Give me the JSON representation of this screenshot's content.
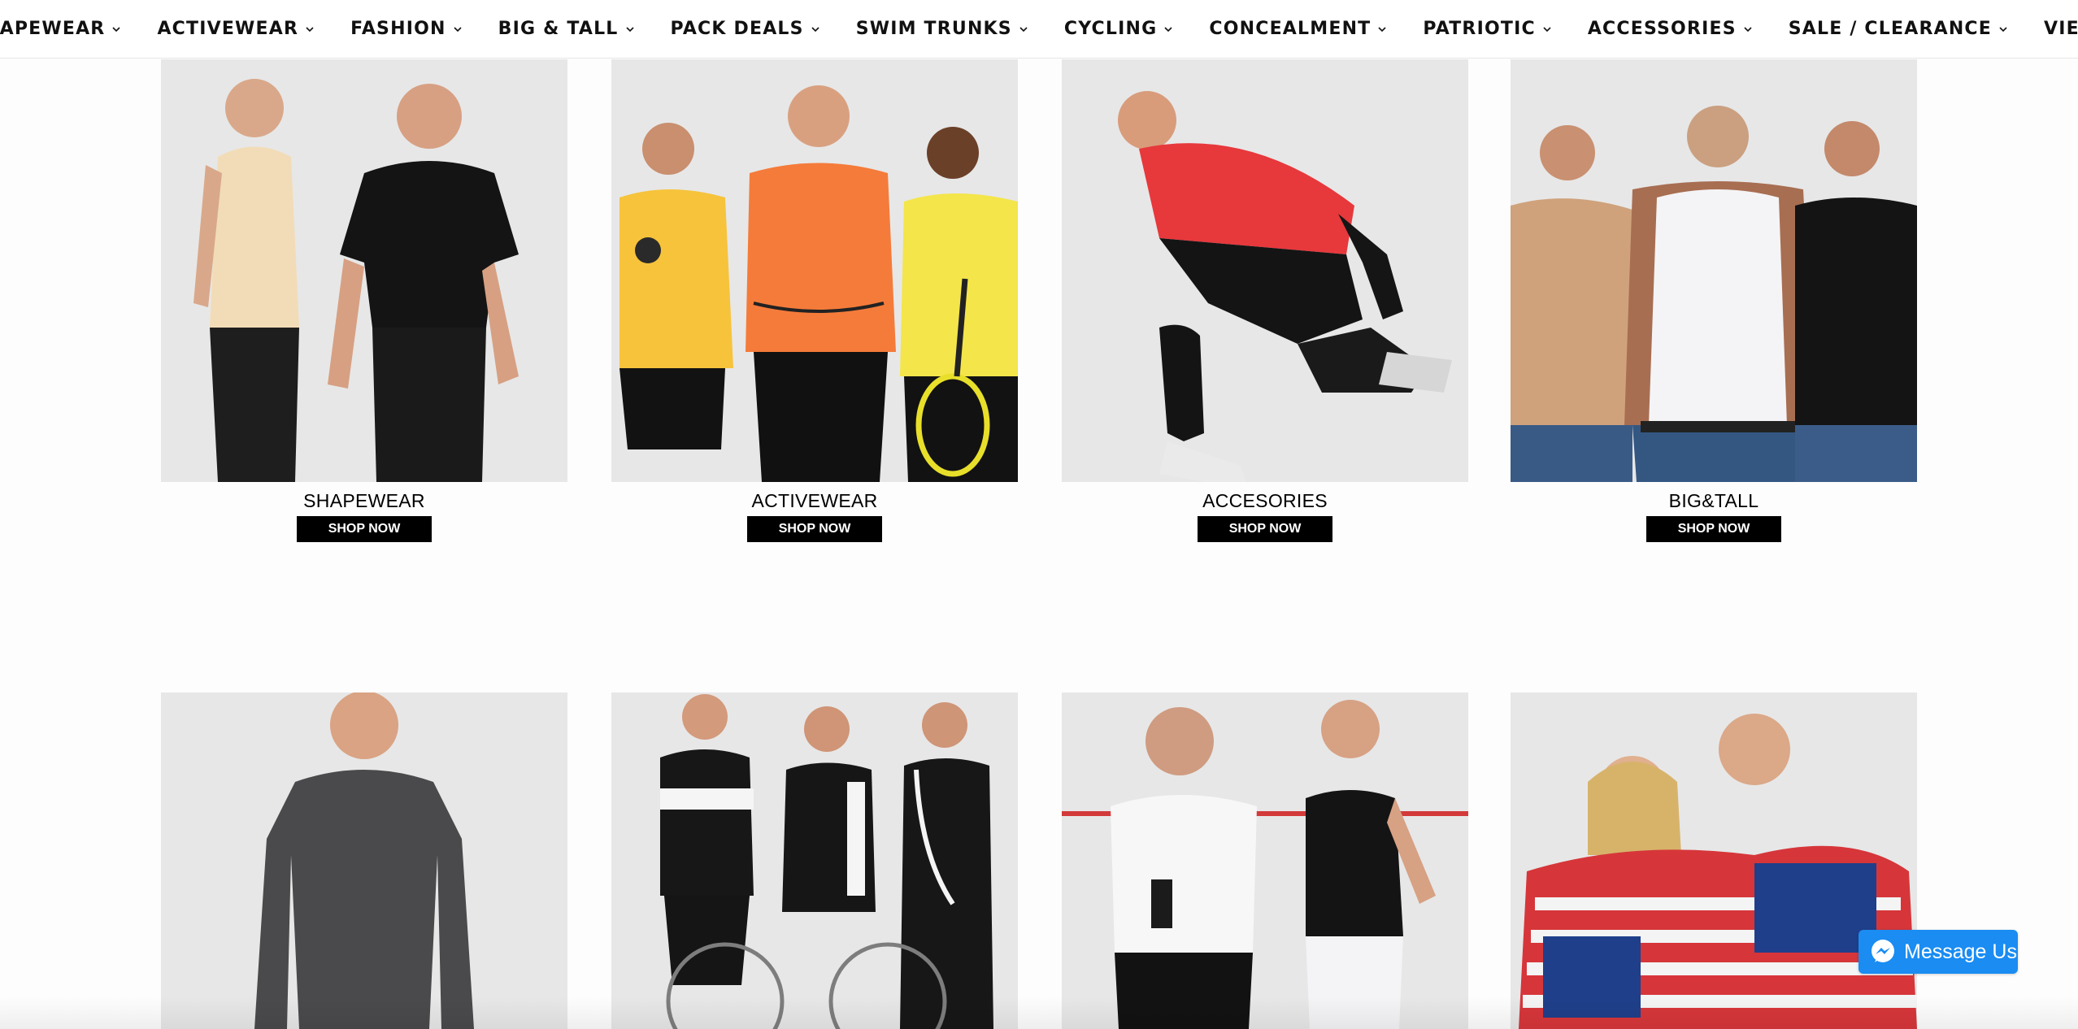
{
  "nav": {
    "items": [
      {
        "label": "MEN SHAPEWEAR"
      },
      {
        "label": "ACTIVEWEAR"
      },
      {
        "label": "FASHION"
      },
      {
        "label": "BIG & TALL"
      },
      {
        "label": "PACK DEALS"
      },
      {
        "label": "SWIM TRUNKS"
      },
      {
        "label": "CYCLING"
      },
      {
        "label": "CONCEALMENT"
      },
      {
        "label": "PATRIOTIC"
      },
      {
        "label": "ACCESSORIES"
      },
      {
        "label": "SALE / CLEARANCE"
      },
      {
        "label": "VIEW ALL"
      }
    ],
    "dropdown_icon": "chevron-down-icon"
  },
  "tiles": [
    {
      "caption": "SHAPEWEAR",
      "button": "SHOP NOW",
      "photo": "two-men-shapewear-photo"
    },
    {
      "caption": "ACTIVEWEAR",
      "button": "SHOP NOW",
      "photo": "three-men-activewear-photo"
    },
    {
      "caption": "ACCESORIES",
      "button": "SHOP NOW",
      "photo": "man-kneeling-accessories-photo"
    },
    {
      "caption": "BIG&TALL",
      "button": "SHOP NOW",
      "photo": "three-men-tanks-photo"
    },
    {
      "photo": "man-long-sleeve-photo"
    },
    {
      "photo": "three-men-cycling-photo"
    },
    {
      "photo": "concealment-couple-photo"
    },
    {
      "photo": "patriotic-couple-photo"
    }
  ],
  "messenger": {
    "label": "Message Us",
    "icon": "messenger-icon"
  },
  "colors": {
    "photo_bg": "#e7e7e7",
    "button_bg": "#000000",
    "messenger_bg": "#1a8cf2"
  }
}
